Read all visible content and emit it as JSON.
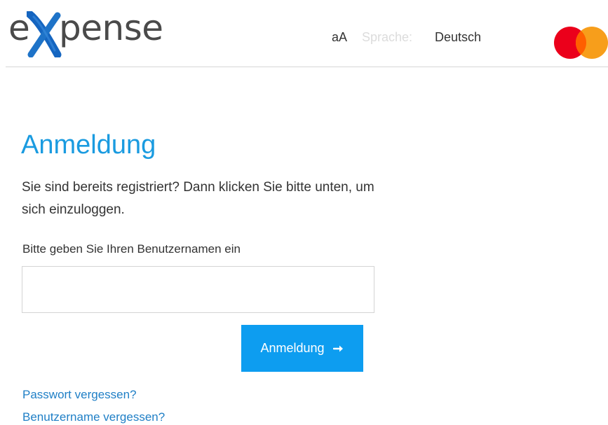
{
  "header": {
    "logo": {
      "text_e": "e",
      "text_rest": "pense",
      "brand": "eXpense",
      "colors": {
        "x_mark": "#1565c0",
        "text": "#4a4a4a"
      }
    },
    "font_size_toggle": "aA",
    "language_label": "Sprache:",
    "language_value": "Deutsch",
    "partner_logo": {
      "icon": "mastercard-logo-icon",
      "colors": {
        "left_circle": "#eb001b",
        "right_circle": "#f79e1b",
        "overlap": "#ff5f00"
      }
    }
  },
  "main": {
    "title": "Anmeldung",
    "intro": "Sie sind bereits registriert? Dann klicken Sie bitte unten, um sich einzuloggen.",
    "username_label": "Bitte geben Sie Ihren Benutzernamen ein",
    "username_value": "",
    "login_button": {
      "label": "Anmeldung",
      "icon": "arrow-right-icon",
      "color": "#0d9df0"
    },
    "links": {
      "forgot_password": "Passwort vergessen?",
      "forgot_username": "Benutzername vergessen?"
    }
  },
  "colors": {
    "accent": "#1a9be0",
    "link": "#1f7fc6",
    "text": "#333333"
  }
}
